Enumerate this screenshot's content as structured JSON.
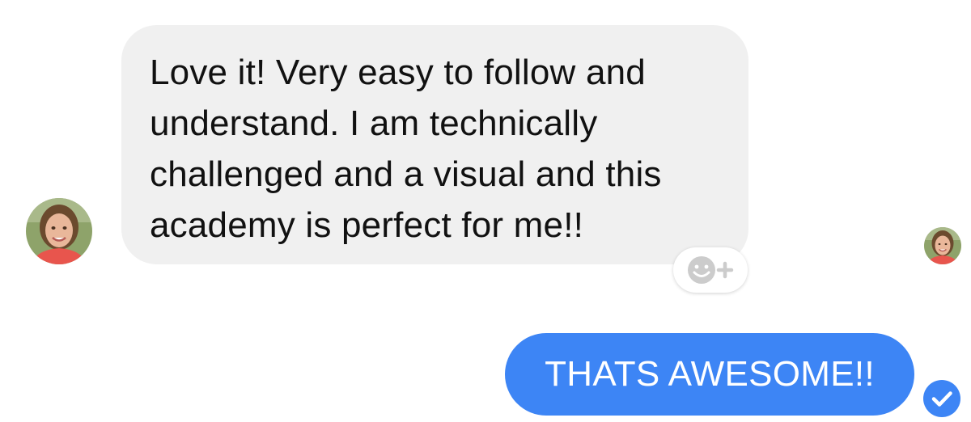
{
  "conversation": {
    "incoming": {
      "lines": [
        "Love it!  Very easy to follow and",
        "understand.  I am technically",
        "challenged and a visual and this",
        "academy is perfect for me!!"
      ],
      "reaction_icon": "smiley-plus-icon"
    },
    "outgoing": {
      "text": "THATS AWESOME!!",
      "status_icon": "delivered-check-icon"
    }
  },
  "colors": {
    "incoming_bubble": "#f0f0f0",
    "outgoing_bubble": "#3d85f5",
    "text_dark": "#111111",
    "text_light": "#ffffff"
  }
}
